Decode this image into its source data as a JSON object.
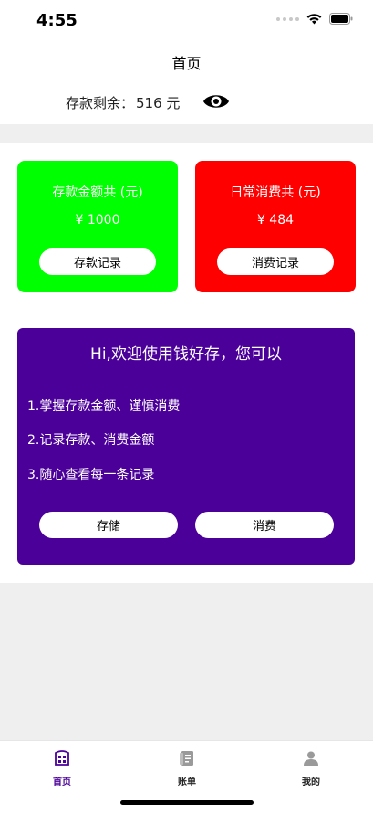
{
  "status_bar": {
    "time": "4:55"
  },
  "nav": {
    "title": "首页"
  },
  "balance": {
    "label": "存款剩余：",
    "amount": "516 元"
  },
  "cards": {
    "deposit": {
      "title": "存款金额共 (元)",
      "amount": "¥ 1000",
      "button": "存款记录"
    },
    "expense": {
      "title": "日常消费共 (元)",
      "amount": "¥ 484",
      "button": "消费记录"
    }
  },
  "welcome": {
    "title": "Hi,欢迎使用钱好存，您可以",
    "items": [
      "1.掌握存款金额、谨慎消费",
      "2.记录存款、消费金额",
      "3.随心查看每一条记录"
    ],
    "save_button": "存储",
    "spend_button": "消费"
  },
  "tabs": [
    {
      "label": "首页",
      "icon": "home-icon",
      "active": true
    },
    {
      "label": "账单",
      "icon": "bill-icon",
      "active": false
    },
    {
      "label": "我的",
      "icon": "profile-icon",
      "active": false
    }
  ],
  "colors": {
    "deposit_card": "#00ff00",
    "expense_card": "#ff0000",
    "welcome_card": "#4b0099",
    "tab_active": "#4b0099",
    "tab_inactive": "#9a9a9a"
  }
}
